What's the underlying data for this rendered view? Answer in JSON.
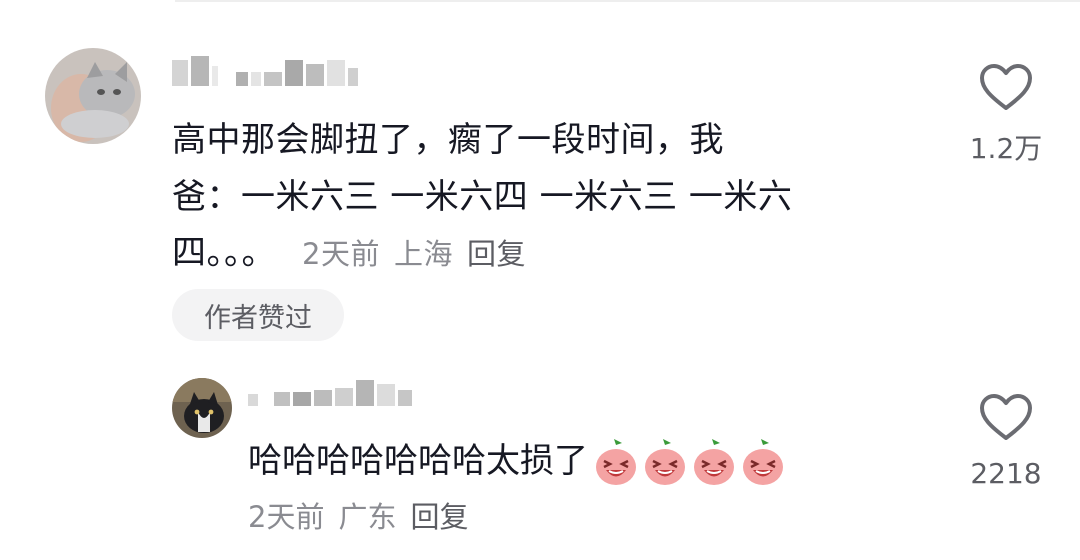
{
  "comment": {
    "text_line1": "高中那会脚扭了，瘸了一段时间，我",
    "text_line2": "爸：一米六三 一米六四 一米六三 一米六",
    "text_line3": "四。。。",
    "time": "2天前",
    "location": "上海",
    "reply_label": "回复",
    "author_liked_label": "作者赞过",
    "likes": "1.2万",
    "like_icon": "heart-outline-icon"
  },
  "reply": {
    "text": "哈哈哈哈哈哈哈太损了",
    "emojis": [
      "laughing-peach-emoji",
      "laughing-peach-emoji",
      "laughing-peach-emoji",
      "laughing-peach-emoji"
    ],
    "time": "2天前",
    "location": "广东",
    "reply_label": "回复",
    "likes": "2218",
    "like_icon": "heart-outline-icon"
  },
  "colors": {
    "text_primary": "#161823",
    "text_meta": "#8a8b91",
    "badge_bg": "#f3f3f4",
    "emoji_body": "#f4a3a3",
    "emoji_leaf": "#3a9b3a"
  }
}
